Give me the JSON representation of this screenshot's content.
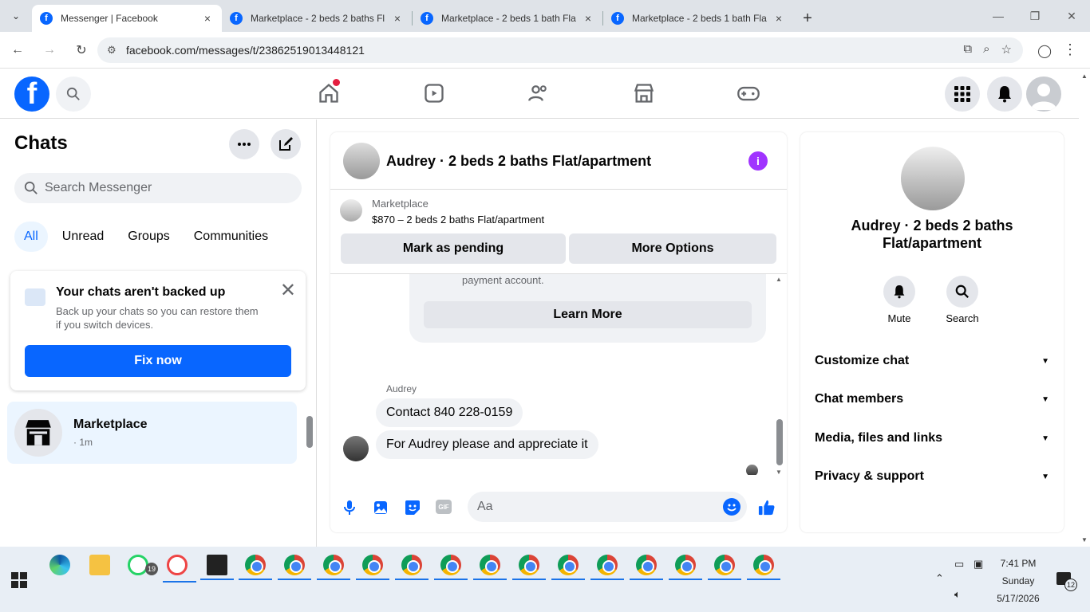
{
  "browser": {
    "tabs": [
      {
        "title": "Messenger | Facebook",
        "active": true
      },
      {
        "title": "Marketplace - 2 beds 2 baths Fl",
        "active": false
      },
      {
        "title": "Marketplace - 2 beds 1 bath Fla",
        "active": false
      },
      {
        "title": "Marketplace - 2 beds 1 bath Fla",
        "active": false
      }
    ],
    "url": "facebook.com/messages/t/23862519013448121",
    "favicon_letter": "f"
  },
  "fb": {
    "logo_letter": "f"
  },
  "sidebar": {
    "title": "Chats",
    "search_placeholder": "Search Messenger",
    "filters": [
      "All",
      "Unread",
      "Groups",
      "Communities"
    ],
    "backup": {
      "title": "Your chats aren't backed up",
      "desc": "Back up your chats so you can restore them if you switch devices.",
      "close": "✕",
      "button": "Fix now"
    },
    "chat": {
      "name": "Marketplace",
      "time": "· 1m"
    }
  },
  "conversation": {
    "title": "Audrey · 2 beds 2 baths Flat/apartment",
    "info": "i",
    "marketplace_label": "Marketplace",
    "listing": "$870 – 2 beds 2 baths Flat/apartment",
    "mark_pending": "Mark as pending",
    "more_options": "More Options",
    "card_text": "payment account.",
    "learn_more": "Learn More",
    "sender": "Audrey",
    "messages": [
      "Contact 840 228-0159",
      "For Audrey please and appreciate it"
    ],
    "composer_placeholder": "Aa",
    "gif_label": "GIF"
  },
  "details": {
    "name": "Audrey · 2 beds 2 baths Flat/apartment",
    "mute": "Mute",
    "search": "Search",
    "sections": [
      "Customize chat",
      "Chat members",
      "Media, files and links",
      "Privacy & support"
    ]
  },
  "taskbar": {
    "whatsapp_badge": "19",
    "time": "7:41 PM",
    "day": "Sunday",
    "date": "5/17/2026",
    "notifications": "12"
  },
  "colors": {
    "accent": "#0866ff",
    "info": "#a033ff",
    "notification_dot": "#e41e3f"
  }
}
